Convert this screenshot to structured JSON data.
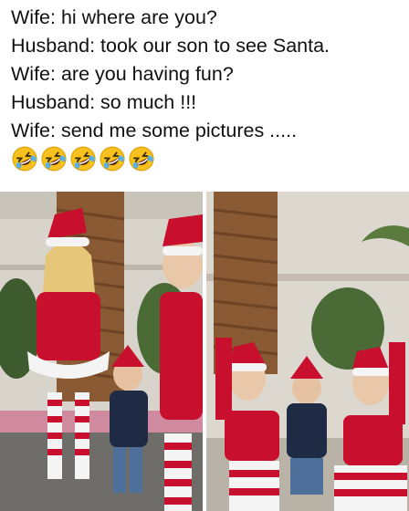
{
  "caption": {
    "lines": [
      "Wife: hi where are you?",
      "Husband: took our son to see Santa.",
      "Wife: are you having fun?",
      "Husband: so much !!!",
      "Wife: send me some pictures ....."
    ],
    "emoji_count": 5,
    "emoji_icon": "rolling-on-floor-laughing-emoji"
  },
  "photos": [
    {
      "icon": "photo-standing-group"
    },
    {
      "icon": "photo-sitting-group"
    }
  ],
  "colors": {
    "santa_red": "#c8102e",
    "fur_white": "#f4f4f4",
    "wall": "#d9d6cf",
    "palm": "#8a5a35",
    "jacket": "#1f2b45",
    "emoji_face": "#f7c21b"
  }
}
